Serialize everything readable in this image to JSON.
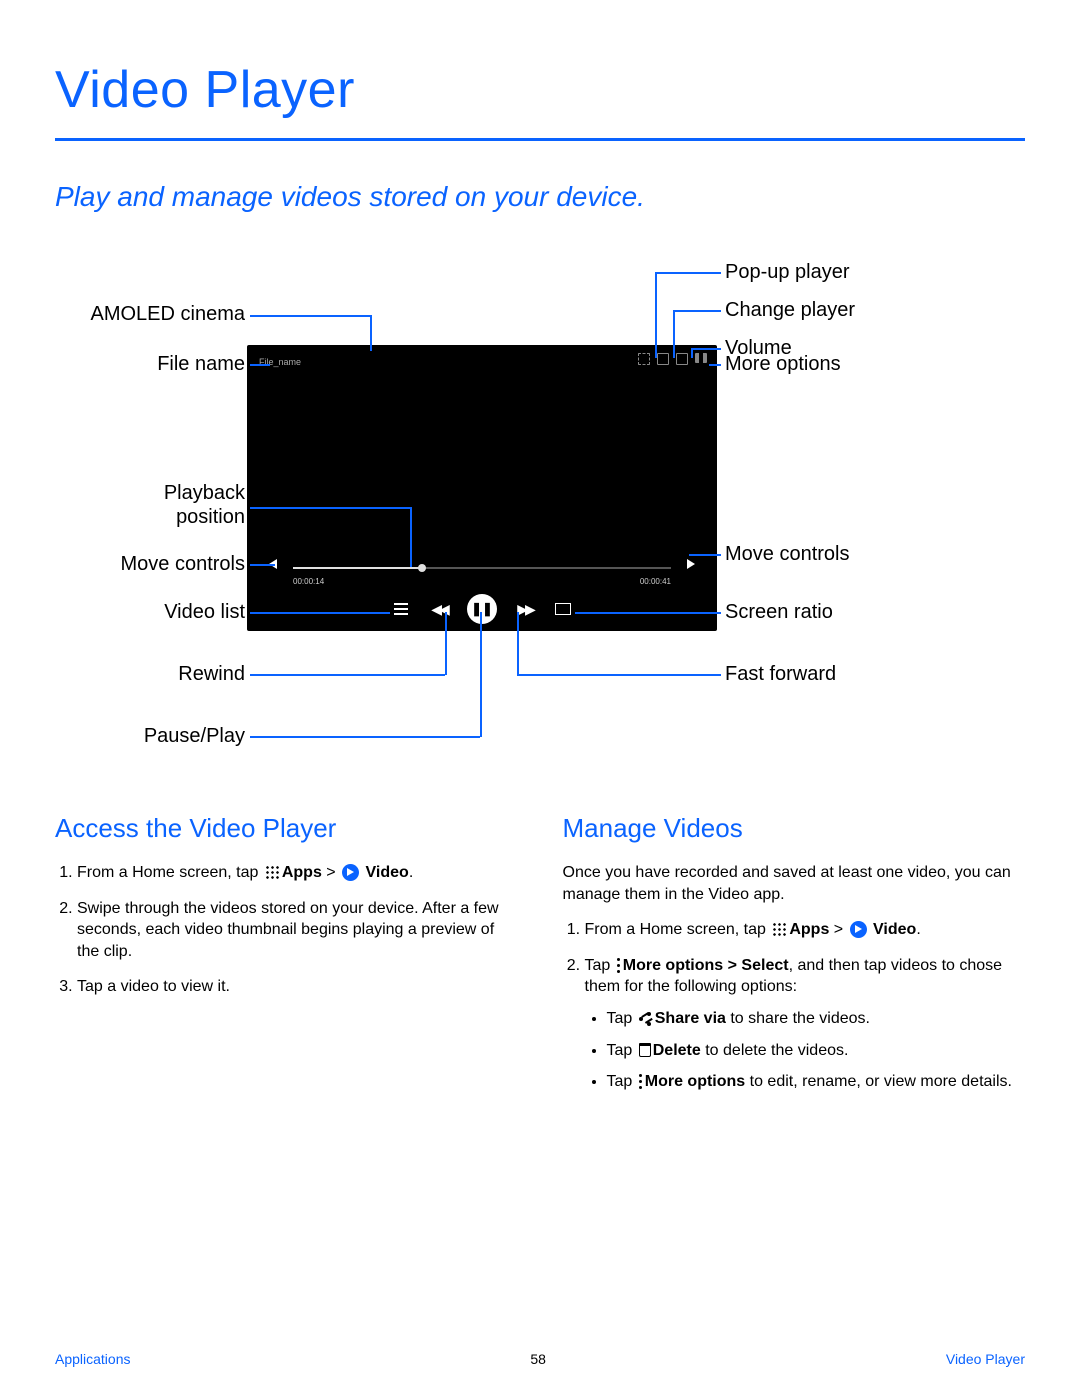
{
  "title": "Video Player",
  "subtitle": "Play and manage videos stored on your device.",
  "player": {
    "filename": "File_name",
    "time_elapsed": "00:00:14",
    "time_total": "00:00:41"
  },
  "labels": {
    "amoled": "AMOLED cinema",
    "filename": "File name",
    "playback": "Playback\nposition",
    "move_controls": "Move controls",
    "video_list": "Video list",
    "rewind": "Rewind",
    "pause_play": "Pause/Play",
    "popup": "Pop-up player",
    "change_player": "Change player",
    "volume": "Volume",
    "more_options": "More options",
    "screen_ratio": "Screen ratio",
    "fast_forward": "Fast forward"
  },
  "sections": {
    "access": {
      "title": "Access the Video Player",
      "step1_pre": "From a Home screen, tap ",
      "apps": "Apps",
      "gt": " > ",
      "video": "Video",
      "dot": ".",
      "step2": "Swipe through the videos stored on your device. After a few seconds, each video thumbnail begins playing a preview of the clip.",
      "step3": "Tap a video to view it."
    },
    "manage": {
      "title": "Manage Videos",
      "intro": "Once you have recorded and saved at least one video, you can manage them in the Video app.",
      "step1_pre": "From a Home screen, tap ",
      "step2_pre": "Tap ",
      "more_sel": "More options > Select",
      "step2_post": ", and then tap videos to chose them for the following options:",
      "b1_pre": "Tap ",
      "share": "Share via",
      "b1_post": " to share the videos.",
      "del": "Delete",
      "b2_post": "  to delete the videos.",
      "more": "More options",
      "b3_post": " to edit, rename, or view more details."
    }
  },
  "footer": {
    "left": "Applications",
    "page": "58",
    "right": "Video Player"
  }
}
